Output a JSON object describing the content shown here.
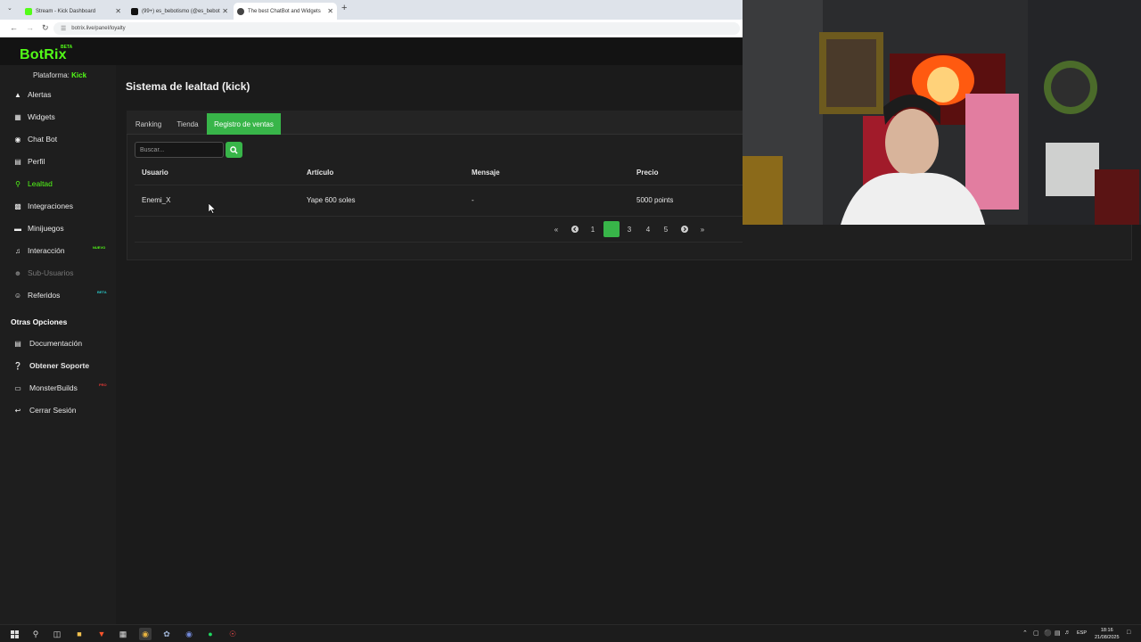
{
  "browser": {
    "tabs": [
      {
        "label": "Stream - Kick Dashboard",
        "icon": "kick-favicon",
        "color": "#53fc18"
      },
      {
        "label": "(99+) es_bebotismo (@es_bebot",
        "icon": "x-favicon",
        "color": "#000000"
      },
      {
        "label": "The best ChatBot and Widgets",
        "icon": "botrix-favicon",
        "color": "#222222"
      }
    ],
    "url": "botrix.live/panel/loyalty"
  },
  "app": {
    "logo": "BotRix",
    "logo_badge": "BETA",
    "platform_label": "Plataforma:",
    "platform_value": "Kick"
  },
  "sidebar": {
    "items": [
      {
        "label": "Alertas",
        "icon": "warning-icon"
      },
      {
        "label": "Widgets",
        "icon": "grid-icon"
      },
      {
        "label": "Chat Bot",
        "icon": "robot-icon"
      },
      {
        "label": "Perfil",
        "icon": "id-card-icon"
      },
      {
        "label": "Lealtad",
        "icon": "trophy-icon",
        "active": true
      },
      {
        "label": "Integraciones",
        "icon": "integration-icon"
      },
      {
        "label": "Minijuegos",
        "icon": "gamepad-icon"
      },
      {
        "label": "Interacción",
        "icon": "music-icon",
        "badge": "NUEVO"
      },
      {
        "label": "Sub-Usuarios",
        "icon": "users-icon",
        "disabled": true
      },
      {
        "label": "Referidos",
        "icon": "referral-icon",
        "badge": "BETA"
      }
    ],
    "section_title": "Otras Opciones",
    "other_items": [
      {
        "label": "Documentación",
        "icon": "book-icon"
      },
      {
        "label": "Obtener Soporte",
        "icon": "help-icon"
      },
      {
        "label": "MonsterBuilds",
        "icon": "laptop-icon",
        "badge": "PRO"
      },
      {
        "label": "Cerrar Sesión",
        "icon": "logout-icon"
      }
    ]
  },
  "main": {
    "title": "Sistema de lealtad (kick)",
    "tabs": [
      "Ranking",
      "Tienda",
      "Registro de ventas"
    ],
    "active_tab": "Registro de ventas",
    "search_placeholder": "Buscar...",
    "table": {
      "headers": [
        "Usuario",
        "Artículo",
        "Mensaje",
        "Precio"
      ],
      "rows": [
        [
          "Enemi_X",
          "Yape 600 soles",
          "-",
          "5000 points"
        ]
      ]
    },
    "pagination": {
      "pages": [
        "1",
        "2",
        "3",
        "4",
        "5"
      ],
      "current": "2"
    }
  },
  "taskbar": {
    "language": "ESP",
    "time": "18:16",
    "date": "21/08/2025"
  },
  "colors": {
    "accent": "#38b549",
    "brand": "#53fc18",
    "background": "#1b1b1b"
  }
}
